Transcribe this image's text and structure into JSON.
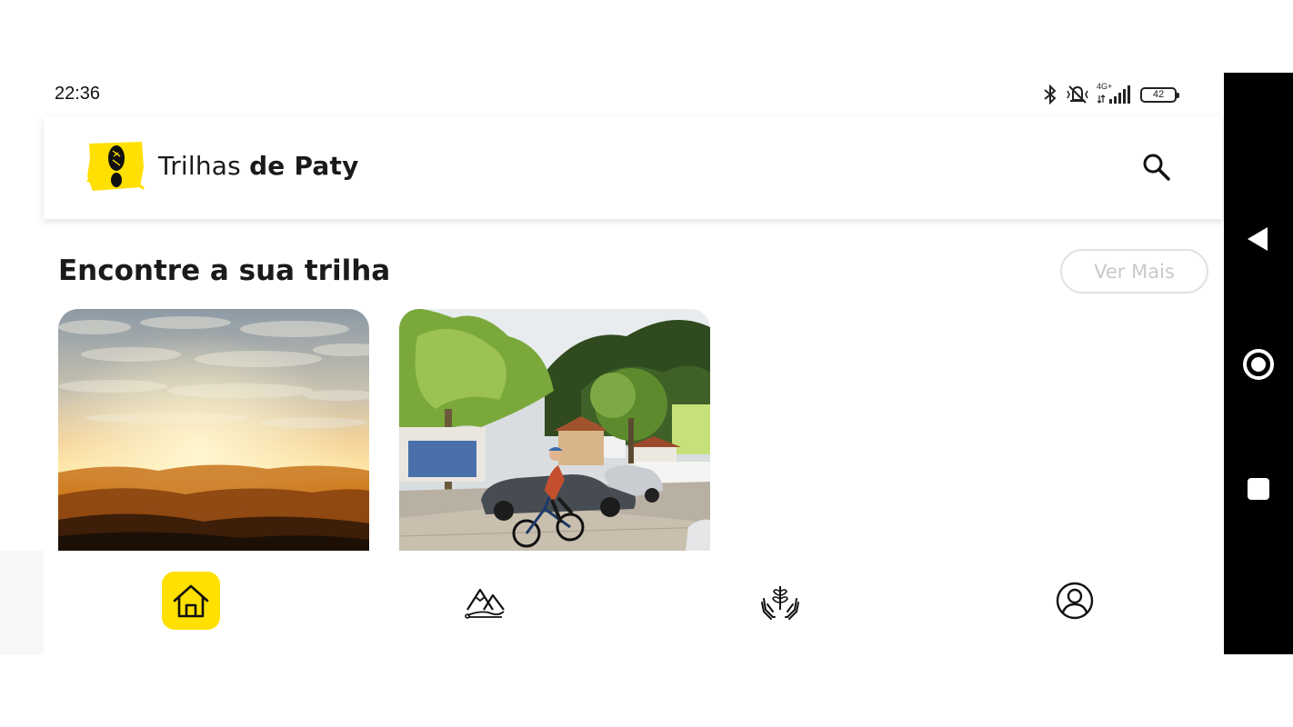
{
  "status_bar": {
    "time": "22:36",
    "network": "4G+",
    "battery": "42",
    "icons": [
      "bluetooth-icon",
      "silent-bell-icon",
      "signal-icon",
      "battery-icon"
    ]
  },
  "header": {
    "title_regular": "Trilhas",
    "title_bold": "de Paty",
    "logo_icon": "footprint-logo-icon",
    "search_icon": "search-icon"
  },
  "section": {
    "title": "Encontre a sua trilha",
    "more_label": "Ver Mais"
  },
  "cards": [
    {
      "image": "sunset-mountains-photo"
    },
    {
      "image": "cyclist-town-street-photo"
    }
  ],
  "bottom_nav": {
    "items": [
      {
        "icon": "home-icon",
        "active": true
      },
      {
        "icon": "mountain-trail-icon",
        "active": false
      },
      {
        "icon": "hands-plant-icon",
        "active": false
      },
      {
        "icon": "profile-icon",
        "active": false
      }
    ],
    "accent_color": "#ffe000"
  },
  "android_nav": {
    "icons": [
      "back-icon",
      "home-circle-icon",
      "recents-icon"
    ]
  },
  "colors": {
    "brand_yellow": "#ffe000",
    "text": "#1a1a1a",
    "muted_border": "#e1e1e1"
  }
}
